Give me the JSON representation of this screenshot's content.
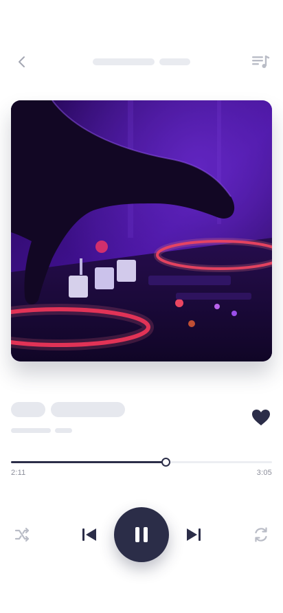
{
  "player": {
    "progress": 0.593,
    "elapsed": "2:11",
    "duration": "3:05",
    "liked": true,
    "playing": true
  },
  "icons": {
    "back": "chevron-left-icon",
    "queue": "playlist-icon",
    "like": "heart-icon",
    "shuffle": "shuffle-icon",
    "previous": "skip-previous-icon",
    "pause": "pause-icon",
    "next": "skip-next-icon",
    "repeat": "repeat-icon"
  },
  "colors": {
    "primary": "#2b2d48",
    "muted_icon": "#b9bcc6",
    "placeholder": "#e6e8ee",
    "cover_accent": "#ff3a5c",
    "cover_base": "#3a0d7a"
  }
}
